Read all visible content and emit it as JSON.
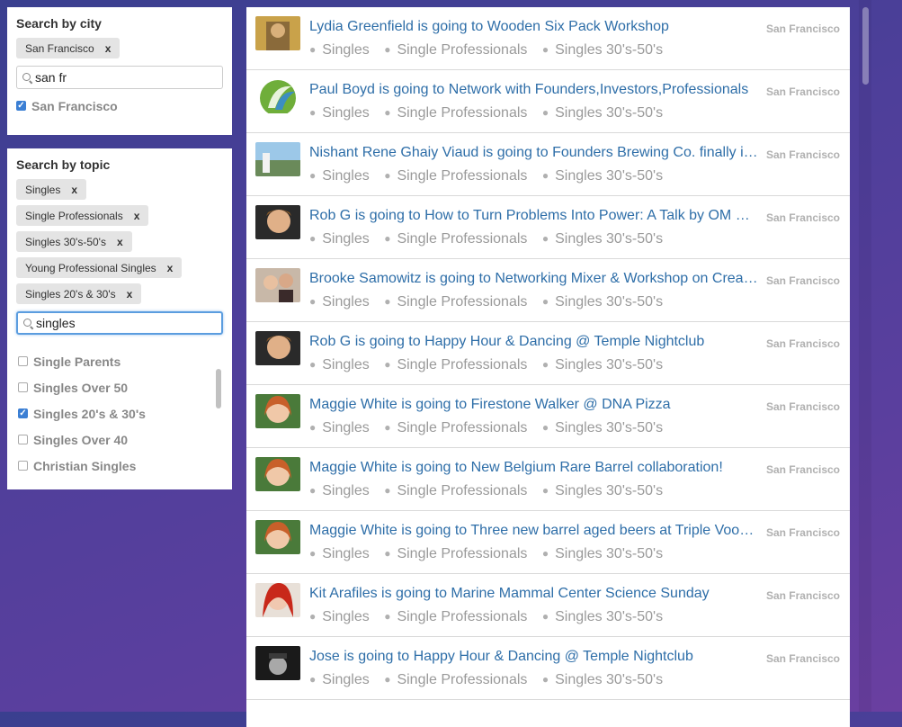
{
  "city_filter": {
    "title": "Search by city",
    "chip_label": "San Francisco",
    "chip_remove": "x",
    "input_value": "san fr",
    "option_label": "San Francisco"
  },
  "topic_filter": {
    "title": "Search by topic",
    "chips": [
      {
        "label": "Singles",
        "remove": "x"
      },
      {
        "label": "Single Professionals",
        "remove": "x"
      },
      {
        "label": "Singles 30's-50's",
        "remove": "x"
      },
      {
        "label": "Young Professional Singles",
        "remove": "x"
      },
      {
        "label": "Singles 20's & 30's",
        "remove": "x"
      }
    ],
    "input_value": "singles",
    "options": [
      {
        "label": "Single Parents",
        "checked": false
      },
      {
        "label": "Singles Over 50",
        "checked": false
      },
      {
        "label": "Singles 20's & 30's",
        "checked": true
      },
      {
        "label": "Singles Over 40",
        "checked": false
      },
      {
        "label": "Christian Singles",
        "checked": false
      }
    ]
  },
  "feed": {
    "tags": [
      "Singles",
      "Single Professionals",
      "Singles 30's-50's"
    ],
    "items": [
      {
        "title": "Lydia Greenfield is going to Wooden Six Pack Workshop",
        "city": "San Francisco"
      },
      {
        "title": "Paul Boyd is going to Network with Founders,Investors,Professionals",
        "city": "San Francisco"
      },
      {
        "title": "Nishant Rene Ghaiy Viaud is going to Founders Brewing Co. finally in SF",
        "city": "San Francisco"
      },
      {
        "title": "Rob G is going to How to Turn Problems Into Power: A Talk by OM Swami",
        "city": "San Francisco"
      },
      {
        "title": "Brooke Samowitz is going to Networking Mixer & Workshop on Creativity",
        "city": "San Francisco"
      },
      {
        "title": "Rob G is going to Happy Hour & Dancing @ Temple Nightclub",
        "city": "San Francisco"
      },
      {
        "title": "Maggie White is going to Firestone Walker @ DNA Pizza",
        "city": "San Francisco"
      },
      {
        "title": "Maggie White is going to New Belgium Rare Barrel collaboration!",
        "city": "San Francisco"
      },
      {
        "title": "Maggie White is going to Three new barrel aged beers at Triple Voodoo",
        "city": "San Francisco"
      },
      {
        "title": "Kit Arafiles is going to Marine Mammal Center Science Sunday",
        "city": "San Francisco"
      },
      {
        "title": "Jose is going to Happy Hour & Dancing @ Temple Nightclub",
        "city": "San Francisco"
      }
    ]
  }
}
